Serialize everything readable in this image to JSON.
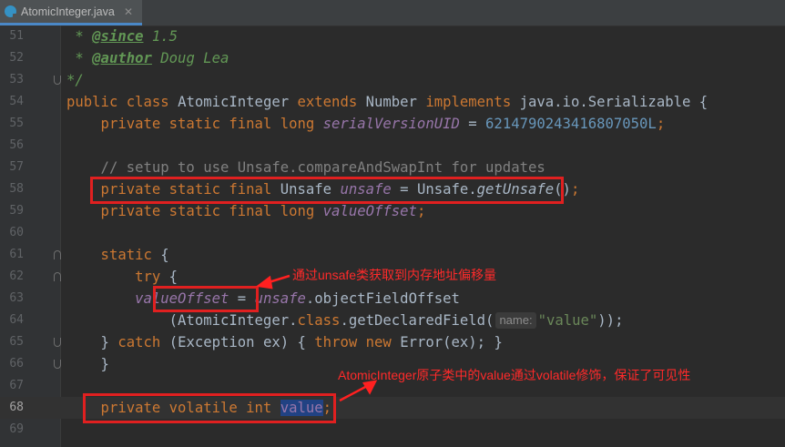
{
  "tab": {
    "filename": "AtomicInteger.java",
    "icon": "java-class-icon"
  },
  "lines": [
    {
      "n": "51"
    },
    {
      "n": "52"
    },
    {
      "n": "53"
    },
    {
      "n": "54"
    },
    {
      "n": "55"
    },
    {
      "n": "56"
    },
    {
      "n": "57"
    },
    {
      "n": "58"
    },
    {
      "n": "59"
    },
    {
      "n": "60"
    },
    {
      "n": "61"
    },
    {
      "n": "62"
    },
    {
      "n": "63"
    },
    {
      "n": "64"
    },
    {
      "n": "65"
    },
    {
      "n": "66"
    },
    {
      "n": "67"
    },
    {
      "n": "68"
    },
    {
      "n": "69"
    }
  ],
  "code": {
    "l51_star": " * ",
    "l51_tag": "@since",
    "l51_rest": " 1.5",
    "l52_star": " * ",
    "l52_tag": "@author",
    "l52_rest": " Doug Lea",
    "l53": "*/",
    "l54_kw1": "public class ",
    "l54_name": "AtomicInteger ",
    "l54_kw2": "extends ",
    "l54_sup": "Number ",
    "l54_kw3": "implements ",
    "l54_rest": "java.io.Serializable {",
    "l55_kw": "    private static final long ",
    "l55_fld": "serialVersionUID",
    "l55_eq": " = ",
    "l55_num": "6214790243416807050L",
    "l55_end": ";",
    "l57": "    // setup to use Unsafe.compareAndSwapInt for updates",
    "l58_kw": "    private static final ",
    "l58_type": "Unsafe ",
    "l58_fld": "unsafe",
    "l58_eq": " = Unsafe.",
    "l58_mth": "getUnsafe",
    "l58_end": "()",
    "l58_semi": ";",
    "l59_kw": "    private static final long ",
    "l59_fld": "valueOffset",
    "l59_semi": ";",
    "l61_kw": "    static ",
    "l61_brace": "{",
    "l62_kw": "        try ",
    "l62_brace": "{",
    "l63_pre": "        ",
    "l63_fld": "valueOffset",
    "l63_eq": " = ",
    "l63_fld2": "unsafe",
    "l63_rest": ".objectFieldOffset",
    "l64_pre": "            (AtomicInteger.",
    "l64_kw": "class",
    "l64_rest": ".getDeclaredField(",
    "l64_hint": "name:",
    "l64_str": "\"value\"",
    "l64_end": "));",
    "l65_pre": "    } ",
    "l65_kw1": "catch ",
    "l65_mid": "(Exception ex) { ",
    "l65_kw2": "throw new ",
    "l65_rest": "Error(ex); }",
    "l66": "    }",
    "l68_kw": "    private volatile int ",
    "l68_fld": "value",
    "l68_semi": ";"
  },
  "annotations": {
    "unsafe_note": "通过unsafe类获取到内存地址偏移量",
    "value_note": "AtomicInteger原子类中的value通过volatile修饰，保证了可见性"
  },
  "colors": {
    "background": "#2b2b2b",
    "keyword": "#cc7832",
    "field": "#9876aa",
    "comment": "#808080",
    "doc": "#629755",
    "number": "#6897bb",
    "string": "#6a8759",
    "annotation_red": "#e02020"
  }
}
